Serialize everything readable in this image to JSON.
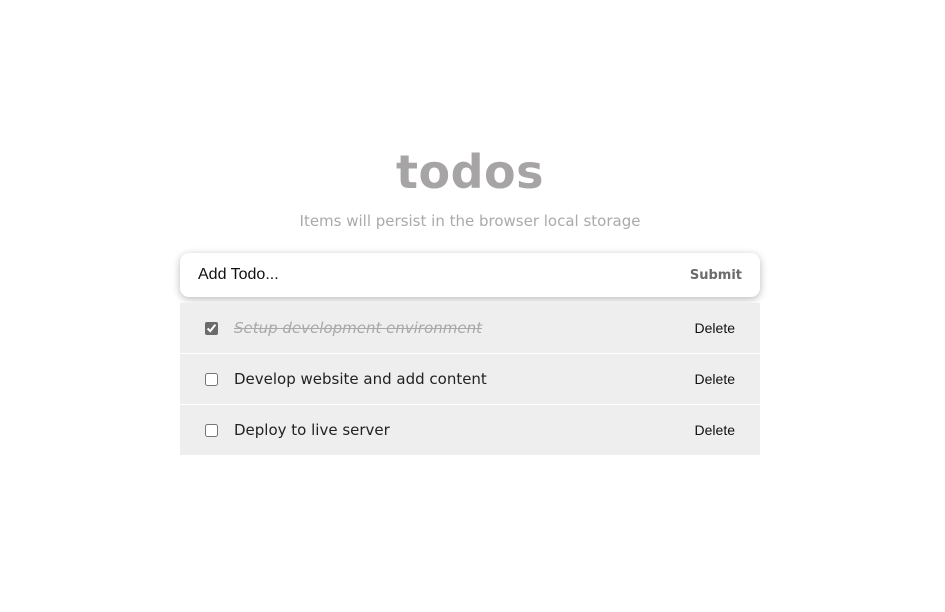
{
  "header": {
    "title": "todos",
    "subtitle": "Items will persist in the browser local storage"
  },
  "form": {
    "input_placeholder": "Add Todo...",
    "input_value": "",
    "submit_label": "Submit"
  },
  "todos": [
    {
      "text": "Setup development environment",
      "completed": true,
      "delete_label": "Delete"
    },
    {
      "text": "Develop website and add content",
      "completed": false,
      "delete_label": "Delete"
    },
    {
      "text": "Deploy to live server",
      "completed": false,
      "delete_label": "Delete"
    }
  ],
  "colors": {
    "title": "#a6a4a4",
    "item_background": "#eeeeee",
    "completed_text": "#a9a9a9"
  }
}
